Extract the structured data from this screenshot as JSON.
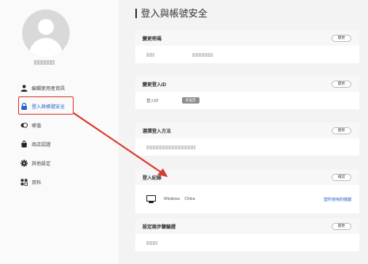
{
  "sidebar": {
    "items": [
      {
        "label": "編輯使用者資訊",
        "icon": "person-icon"
      },
      {
        "label": "登入與帳號安全",
        "icon": "lock-icon"
      },
      {
        "label": "帳值",
        "icon": "coins-icon"
      },
      {
        "label": "商店認證",
        "icon": "shop-icon"
      },
      {
        "label": "其他設定",
        "icon": "gear-icon"
      },
      {
        "label": "資料",
        "icon": "grid-icon"
      }
    ]
  },
  "main": {
    "title": "登入與帳號安全",
    "sections": {
      "change_password": {
        "title": "變更密碼",
        "button": "變更"
      },
      "change_login_id": {
        "title": "變更登入ID",
        "button": "變更",
        "field_label": "登入ID",
        "badge": "未設定"
      },
      "login_method": {
        "title": "選擇登入方法",
        "button": "變更"
      },
      "login_records": {
        "title": "登入紀錄",
        "button": "確認",
        "device": "Windows",
        "location": "China",
        "link": "登所使用的機器"
      },
      "two_step": {
        "title": "設定兩步驟驗證",
        "button": "變更"
      }
    }
  },
  "colors": {
    "accent": "#2a63c9",
    "annotation": "#d83a2c"
  }
}
